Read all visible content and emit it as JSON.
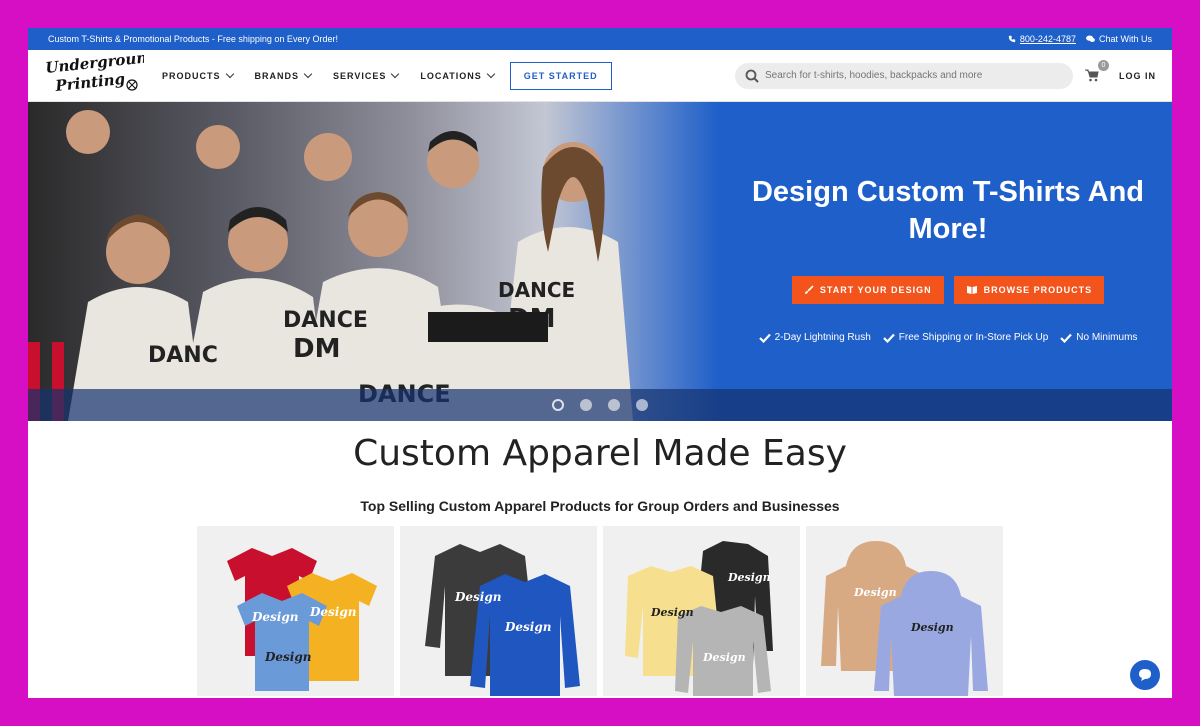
{
  "topbar": {
    "message": "Custom T-Shirts & Promotional Products - Free shipping on Every Order!",
    "phone": "800-242-4787",
    "chat": "Chat With Us"
  },
  "logo": {
    "line1": "Underground",
    "line2": "Printing"
  },
  "nav": {
    "items": [
      {
        "label": "PRODUCTS"
      },
      {
        "label": "BRANDS"
      },
      {
        "label": "SERVICES"
      },
      {
        "label": "LOCATIONS"
      }
    ],
    "get_started": "GET STARTED",
    "search_placeholder": "Search for t-shirts, hoodies, backpacks and more",
    "cart_count": "0",
    "login": "LOG IN"
  },
  "hero": {
    "title": "Design Custom T-Shirts And More!",
    "start_button": "START YOUR DESIGN",
    "browse_button": "BROWSE PRODUCTS",
    "features": [
      "2-Day Lightning Rush",
      "Free Shipping or In-Store Pick Up",
      "No Minimums"
    ],
    "slide_count": 4,
    "active_slide": 1
  },
  "main": {
    "title": "Custom Apparel Made Easy",
    "subtitle": "Top Selling Custom Apparel Products for Group Orders and Businesses"
  },
  "colors": {
    "brand_blue": "#1f5fc9",
    "cta_orange": "#f2541b",
    "frame_magenta": "#d60fc4"
  }
}
